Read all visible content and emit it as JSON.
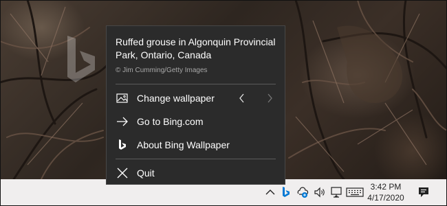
{
  "flyout": {
    "title": "Ruffed grouse in Algonquin Provincial Park, Ontario, Canada",
    "credit": "© Jim Cumming/Getty Images",
    "items": [
      {
        "label": "Change wallpaper",
        "icon": "image-icon"
      },
      {
        "label": "Go to Bing.com",
        "icon": "arrow-right-icon"
      },
      {
        "label": "About Bing Wallpaper",
        "icon": "bing-logo-icon"
      },
      {
        "label": "Quit",
        "icon": "close-icon"
      }
    ],
    "prev_icon": "chevron-left-icon",
    "next_icon": "chevron-right-icon"
  },
  "taskbar": {
    "tray_icons": [
      "chevron-up-icon",
      "bing-wallpaper-icon",
      "cloud-sync-icon",
      "volume-icon",
      "network-icon",
      "keyboard-icon"
    ],
    "time": "3:42 PM",
    "date": "4/17/2020",
    "notification_icon": "action-center-icon"
  },
  "colors": {
    "flyout_bg": "#2b2b2b",
    "bing_accent": "#0078d4",
    "taskbar_bg": "#f0eeee"
  }
}
